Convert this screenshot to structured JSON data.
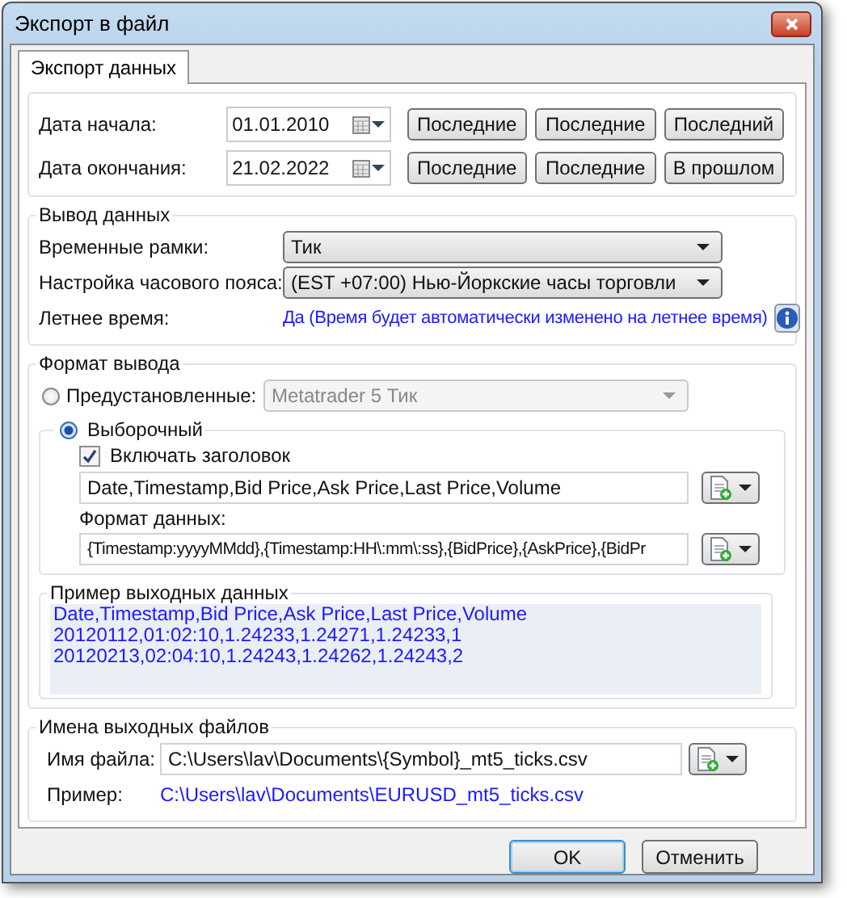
{
  "window": {
    "title": "Экспорт в файл"
  },
  "tabs": [
    {
      "label": "Экспорт данных",
      "selected": true
    }
  ],
  "date_range": {
    "rows": [
      {
        "label": "Дата начала:",
        "value": "01.01.2010",
        "buttons": [
          "Последние",
          "Последние",
          "Последний"
        ]
      },
      {
        "label": "Дата окончания:",
        "value": "21.02.2022",
        "buttons": [
          "Последние",
          "Последние",
          "В прошлом"
        ]
      }
    ]
  },
  "data_output": {
    "title": "Вывод данных",
    "timeframe": {
      "label": "Временные рамки:",
      "value": "Тик"
    },
    "timezone": {
      "label": "Настройка часового пояса:",
      "value": "(EST +07:00) Нью-Йоркские часы торговли"
    },
    "dst": {
      "label": "Летнее время:",
      "value": "Да (Время будет автоматически изменено на летнее время)"
    }
  },
  "output_format": {
    "title": "Формат вывода",
    "options": [
      {
        "label": "Предустановленные:",
        "selected": false
      },
      {
        "label": "Выборочный",
        "selected": true
      }
    ],
    "preset": {
      "value": "Metatrader 5 Тик",
      "disabled": true
    },
    "include_header": {
      "label": "Включать заголовок",
      "checked": true
    },
    "header_value": "Date,Timestamp,Bid Price,Ask Price,Last Price,Volume",
    "data_format": {
      "label": "Формат данных:",
      "value": "{Timestamp:yyyyMMdd},{Timestamp:HH\\:mm\\:ss},{BidPrice},{AskPrice},{BidPr"
    }
  },
  "sample": {
    "title": "Пример выходных данных",
    "lines": [
      "Date,Timestamp,Bid Price,Ask Price,Last Price,Volume",
      "20120112,01:02:10,1.24233,1.24271,1.24233,1",
      "20120213,02:04:10,1.24243,1.24262,1.24243,2"
    ]
  },
  "file_names": {
    "title": "Имена выходных файлов",
    "file": {
      "label": "Имя файла:",
      "value": "C:\\Users\\lav\\Documents\\{Symbol}_mt5_ticks.csv"
    },
    "example": {
      "label": "Пример:",
      "value": "C:\\Users\\lav\\Documents\\EURUSD_mt5_ticks.csv"
    }
  },
  "buttons": [
    {
      "label": "OK",
      "default": true
    },
    {
      "label": "Отменить",
      "default": false
    }
  ]
}
